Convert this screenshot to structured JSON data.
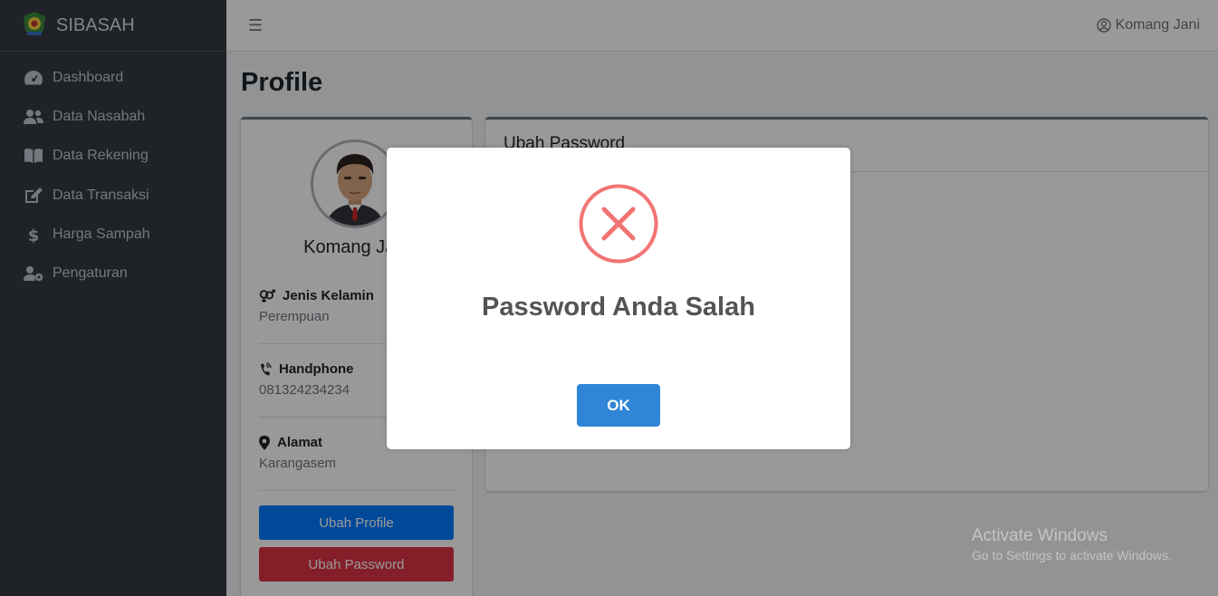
{
  "app": {
    "brand": "SIBASAH"
  },
  "sidebar": {
    "items": [
      {
        "label": "Dashboard",
        "icon": "tachometer-icon"
      },
      {
        "label": "Data Nasabah",
        "icon": "users-icon"
      },
      {
        "label": "Data Rekening",
        "icon": "book-icon"
      },
      {
        "label": "Data Transaksi",
        "icon": "edit-icon"
      },
      {
        "label": "Harga Sampah",
        "icon": "dollar-icon"
      },
      {
        "label": "Pengaturan",
        "icon": "user-cog-icon"
      }
    ]
  },
  "header": {
    "user_name": "Komang Jani"
  },
  "page": {
    "title": "Profile"
  },
  "profile": {
    "name": "Komang Jani",
    "gender_label": "Jenis Kelamin",
    "gender_value": "Perempuan",
    "phone_label": "Handphone",
    "phone_value": "081324234234",
    "address_label": "Alamat",
    "address_value": "Karangasem",
    "edit_profile_label": "Ubah Profile",
    "change_password_label": "Ubah Password"
  },
  "password_card": {
    "title": "Ubah Password"
  },
  "modal": {
    "title": "Password Anda Salah",
    "ok_label": "OK"
  },
  "watermark": {
    "line1": "Activate Windows",
    "line2": "Go to Settings to activate Windows."
  },
  "colors": {
    "sidebar": "#343a40",
    "primary": "#007bff",
    "danger": "#dc3545",
    "success": "#28a745",
    "error_icon": "#f27474",
    "ok_button": "#3085d6"
  }
}
